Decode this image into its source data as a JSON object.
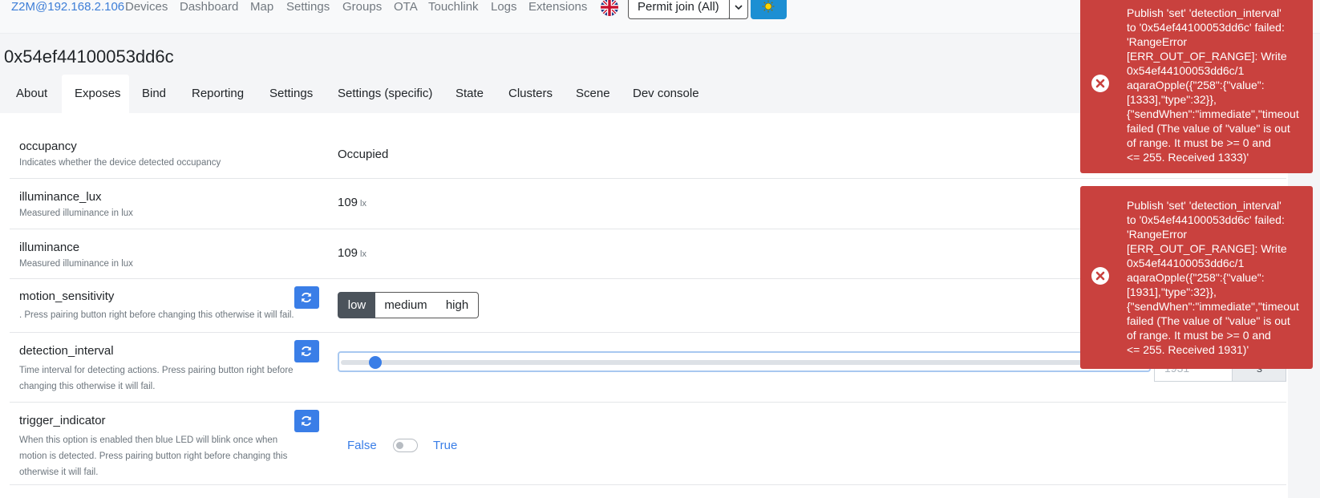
{
  "navbar": {
    "brand": "Z2M@192.168.2.106",
    "links": [
      "Devices",
      "Dashboard",
      "Map",
      "Settings",
      "Groups",
      "OTA",
      "Touchlink",
      "Logs",
      "Extensions"
    ],
    "permit_join_label": "Permit join (All)",
    "caret": "⌄"
  },
  "device": {
    "title": "0x54ef44100053dd6c"
  },
  "tabs": [
    "About",
    "Exposes",
    "Bind",
    "Reporting",
    "Settings",
    "Settings (specific)",
    "State",
    "Clusters",
    "Scene",
    "Dev console"
  ],
  "active_tab": "Exposes",
  "exposes": {
    "occupancy": {
      "name": "occupancy",
      "description": "Indicates whether the device detected occupancy",
      "value": "Occupied"
    },
    "illuminance_lux": {
      "name": "illuminance_lux",
      "description": "Measured illuminance in lux",
      "value": "109",
      "unit": "lx"
    },
    "illuminance": {
      "name": "illuminance",
      "description": "Measured illuminance in lux",
      "value": "109",
      "unit": "lx"
    },
    "motion_sensitivity": {
      "name": "motion_sensitivity",
      "description": ". Press pairing button right before changing this otherwise it will fail.",
      "options": [
        "low",
        "medium",
        "high"
      ],
      "selected": "low"
    },
    "detection_interval": {
      "name": "detection_interval",
      "description_line1": "Time interval for detecting actions. Press pairing button right before",
      "description_line2": "changing this otherwise it will fail.",
      "value": "1931",
      "unit": "s",
      "slider_fraction": 0.035
    },
    "trigger_indicator": {
      "name": "trigger_indicator",
      "description_line1": "When this option is enabled then blue LED will blink once when",
      "description_line2": "motion is detected. Press pairing button right before changing this",
      "description_line3": "otherwise it will fail.",
      "false_label": "False",
      "true_label": "True",
      "value": false
    }
  },
  "toasts": [
    {
      "message": "Publish 'set' 'detection_interval'\nto '0x54ef44100053dd6c' failed:\n'RangeError\n[ERR_OUT_OF_RANGE]: Write\n0x54ef44100053dd6c/1\naqaraOpple({\"258\":{\"value\":\n[1333],\"type\":32}},\n{\"sendWhen\":\"immediate\",\"timeout\nfailed (The value of \"value\" is out\nof range. It must be >= 0 and\n<= 255. Received 1333)'"
    },
    {
      "message": "Publish 'set' 'detection_interval'\nto '0x54ef44100053dd6c' failed:\n'RangeError\n[ERR_OUT_OF_RANGE]: Write\n0x54ef44100053dd6c/1\naqaraOpple({\"258\":{\"value\":\n[1931],\"type\":32}},\n{\"sendWhen\":\"immediate\",\"timeout\nfailed (The value of \"value\" is out\nof range. It must be >= 0 and\n<= 255. Received 1931)'"
    }
  ],
  "colors": {
    "accent": "#3a7ee7",
    "toast_bg": "#c9413e",
    "theme_button": "#1c8fd3"
  }
}
